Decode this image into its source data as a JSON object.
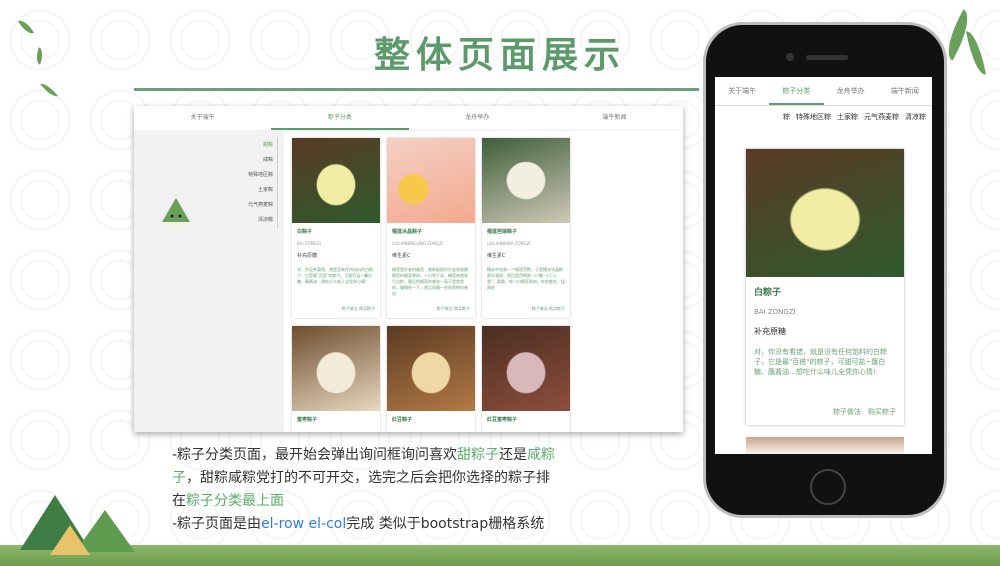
{
  "slide": {
    "title": "整体页面展示",
    "caption": {
      "line1_pre": "-粽子分类页面，最开始会弹出询问框询问喜欢",
      "line1_hl1": "甜粽子",
      "line1_mid": "还是",
      "line1_hl2": "咸粽",
      "line2_hl": "子",
      "line2_rest": "，甜粽咸粽党打的不可开交，选完之后会把你选择的粽子排",
      "line3_pre": "在",
      "line3_hl": "粽子分类最上面",
      "line4_pre": "-粽子页面是由",
      "line4_code1": "el-row",
      "line4_code2": "el-col",
      "line4_post": "完成 类似于bootstrap栅格系统"
    }
  },
  "pc": {
    "nav": [
      "关于端午",
      "粽子分类",
      "龙舟举办",
      "端午新闻"
    ],
    "active_tab": 1,
    "menu": [
      "甜粽",
      "咸粽",
      "特殊地区粽",
      "土家粽",
      "元气燕麦粽",
      "清凉粽"
    ],
    "cards": [
      {
        "name": "白粽子",
        "pinyin": "BAI ZONGZI",
        "tag": "补充原糖",
        "desc": "对，你没有看错，就是没有任何馅料的白粽子，它是最\"百搭\"的粽子，可甜可盐~蘸白糖、蘸酱油…想吃什么味儿全凭你心情!",
        "links": "粽子做法  购买粽子"
      },
      {
        "name": "榴莲冰晶粽子",
        "pinyin": "LIULIANBINGJING ZONGZI",
        "tag": "维生素C",
        "desc": "榴莲是好者的福音，最新配图的外皮和香嫩榴莲的榴莲果肉，一口咬下去，榴莲肉就吸引过粽，最后的榴莲的感觉一直于是就是的，慢慢吃一下，然后再慢一些吃那种你感觉",
        "links": "粽子做法  购买粽子"
      },
      {
        "name": "榴莲芭娘粽子",
        "pinyin": "LIULIANBABA ZONGZI",
        "tag": "维生素C",
        "desc": "糯米中包裹一个榴莲芭粑，于是糯米冰晶粽那么香甜，然后是芭粑那一口感一口\"心香\"，柔嫩，咬一口榴莲果肉，吃的感觉，猛刚吃",
        "links": "粽子做法  购买粽子"
      },
      {
        "name": "蜜枣粽子",
        "pinyin": "",
        "tag": "",
        "desc": "",
        "links": ""
      },
      {
        "name": "红豆粽子",
        "pinyin": "",
        "tag": "",
        "desc": "",
        "links": ""
      },
      {
        "name": "红豆蜜枣粽子",
        "pinyin": "",
        "tag": "",
        "desc": "",
        "links": ""
      }
    ]
  },
  "phone": {
    "nav": [
      "关于端午",
      "粽子分类",
      "龙舟举办",
      "端午新闻"
    ],
    "active_tab": 1,
    "categories": [
      "粽",
      "特殊地区粽",
      "土家粽",
      "元气燕麦粽",
      "清凉粽"
    ],
    "card": {
      "name": "白粽子",
      "pinyin": "BAI ZONGZI",
      "tag": "补充原糖",
      "desc": "对，你没有看错，就是没有任何馅料的白粽子，它是最\"百搭\"的粽子，可甜可盐~蘸白糖、蘸酱油…想吃什么味儿全凭你心情!",
      "link1": "粽子做法",
      "link2": "购买粽子"
    }
  },
  "colors": {
    "accent": "#5a9e6c",
    "highlight_blue": "#2f7de0",
    "title": "#5c9a6c"
  }
}
